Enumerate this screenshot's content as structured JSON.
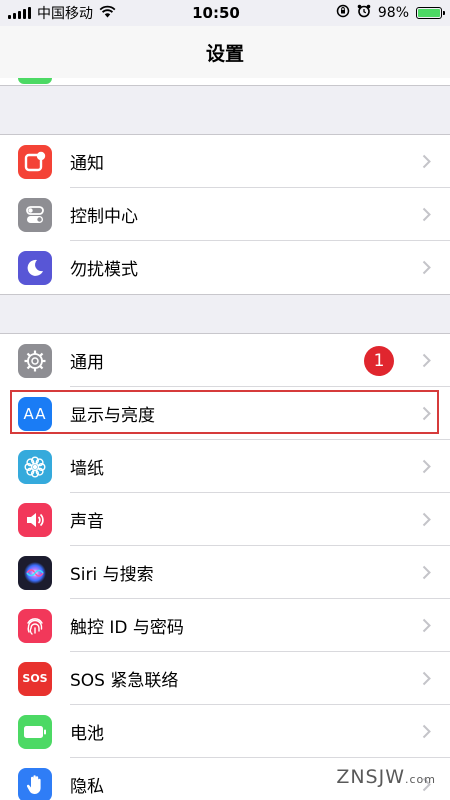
{
  "status_bar": {
    "carrier": "中国移动",
    "time": "10:50",
    "battery_text": "98%",
    "battery_level": 0.98,
    "icons": [
      "signal-icon",
      "wifi-icon",
      "rotation-lock-icon",
      "alarm-icon",
      "battery-icon"
    ]
  },
  "nav": {
    "title": "设置"
  },
  "groups": [
    {
      "items": [
        {
          "label": "通知",
          "icon": "notifications-icon",
          "color": "#f44336"
        },
        {
          "label": "控制中心",
          "icon": "control-center-icon",
          "color": "#8e8e93"
        },
        {
          "label": "勿扰模式",
          "icon": "moon-icon",
          "color": "#5856d6"
        }
      ]
    },
    {
      "items": [
        {
          "label": "通用",
          "icon": "gear-icon",
          "color": "#8e8e93",
          "badge": "1"
        },
        {
          "label": "显示与亮度",
          "icon": "display-brightness-icon",
          "color": "#1a7cf5",
          "icon_text": "AA",
          "highlighted": true
        },
        {
          "label": "墙纸",
          "icon": "wallpaper-flower-icon",
          "color": "#35aadc"
        },
        {
          "label": "声音",
          "icon": "speaker-icon",
          "color": "#f2385a"
        },
        {
          "label": "Siri 与搜索",
          "icon": "siri-icon",
          "color": "#1c1c2e"
        },
        {
          "label": "触控 ID 与密码",
          "icon": "fingerprint-icon",
          "color": "#f2385a"
        },
        {
          "label": "SOS 紧急联络",
          "icon": "sos-icon",
          "color": "#e8322e",
          "icon_text": "SOS"
        },
        {
          "label": "电池",
          "icon": "battery-icon",
          "color": "#4cd964"
        },
        {
          "label": "隐私",
          "icon": "hand-icon",
          "color": "#2f7df6"
        }
      ]
    }
  ],
  "watermark": {
    "text": "ZNSJW",
    "suffix": ".com"
  }
}
